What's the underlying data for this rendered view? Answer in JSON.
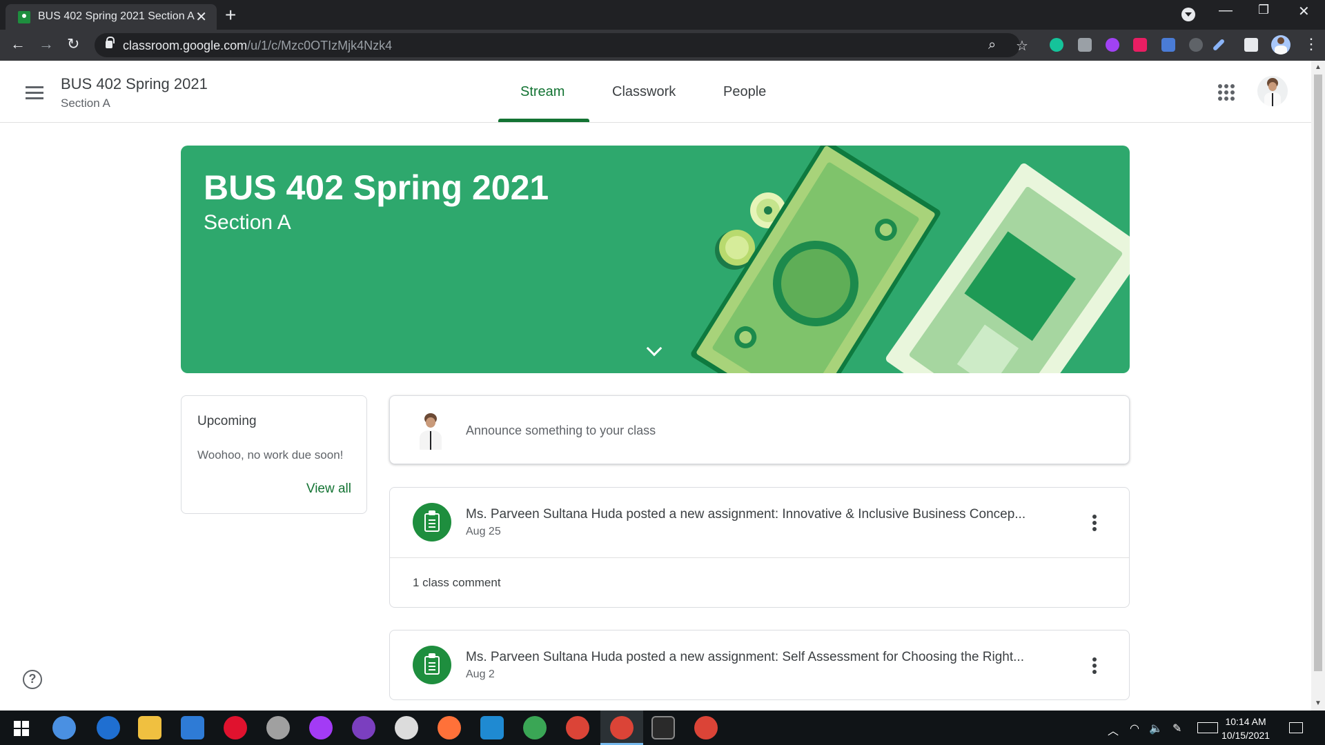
{
  "browser": {
    "tab_title": "BUS 402 Spring 2021 Section A",
    "tab_close": "✕",
    "new_tab": "+",
    "url_host": "classroom.google.com",
    "url_path": "/u/1/c/Mzc0OTIzMjk4Nzk4",
    "window_controls": {
      "minimize": "—",
      "restore": "❐",
      "close": "✕"
    },
    "nav": {
      "back": "←",
      "forward": "→",
      "reload": "↻"
    },
    "omnibox_icons": {
      "zoom": "⌕",
      "bookmark": "☆"
    },
    "menu": "⋮"
  },
  "app": {
    "course_title": "BUS 402 Spring 2021",
    "course_section": "Section A",
    "tabs": [
      {
        "label": "Stream",
        "active": true
      },
      {
        "label": "Classwork",
        "active": false
      },
      {
        "label": "People",
        "active": false
      }
    ]
  },
  "banner": {
    "title": "BUS 402 Spring 2021",
    "subtitle": "Section A",
    "color": "#2ea86d"
  },
  "upcoming": {
    "title": "Upcoming",
    "empty_text": "Woohoo, no work due soon!",
    "view_all": "View all"
  },
  "announce": {
    "placeholder": "Announce something to your class"
  },
  "posts": [
    {
      "title": "Ms. Parveen Sultana Huda posted a new assignment: Innovative & Inclusive Business Concep...",
      "date": "Aug 25",
      "comments": "1 class comment"
    },
    {
      "title": "Ms. Parveen Sultana Huda posted a new assignment: Self Assessment for Choosing the Right...",
      "date": "Aug 2"
    }
  ],
  "help": "?",
  "taskbar": {
    "time": "10:14 AM",
    "date": "10/15/2021",
    "tray_chevron": "︿"
  },
  "colors": {
    "accent_green": "#137333",
    "assignment_icon": "#1e8e3e",
    "chrome_dark": "#202124"
  }
}
